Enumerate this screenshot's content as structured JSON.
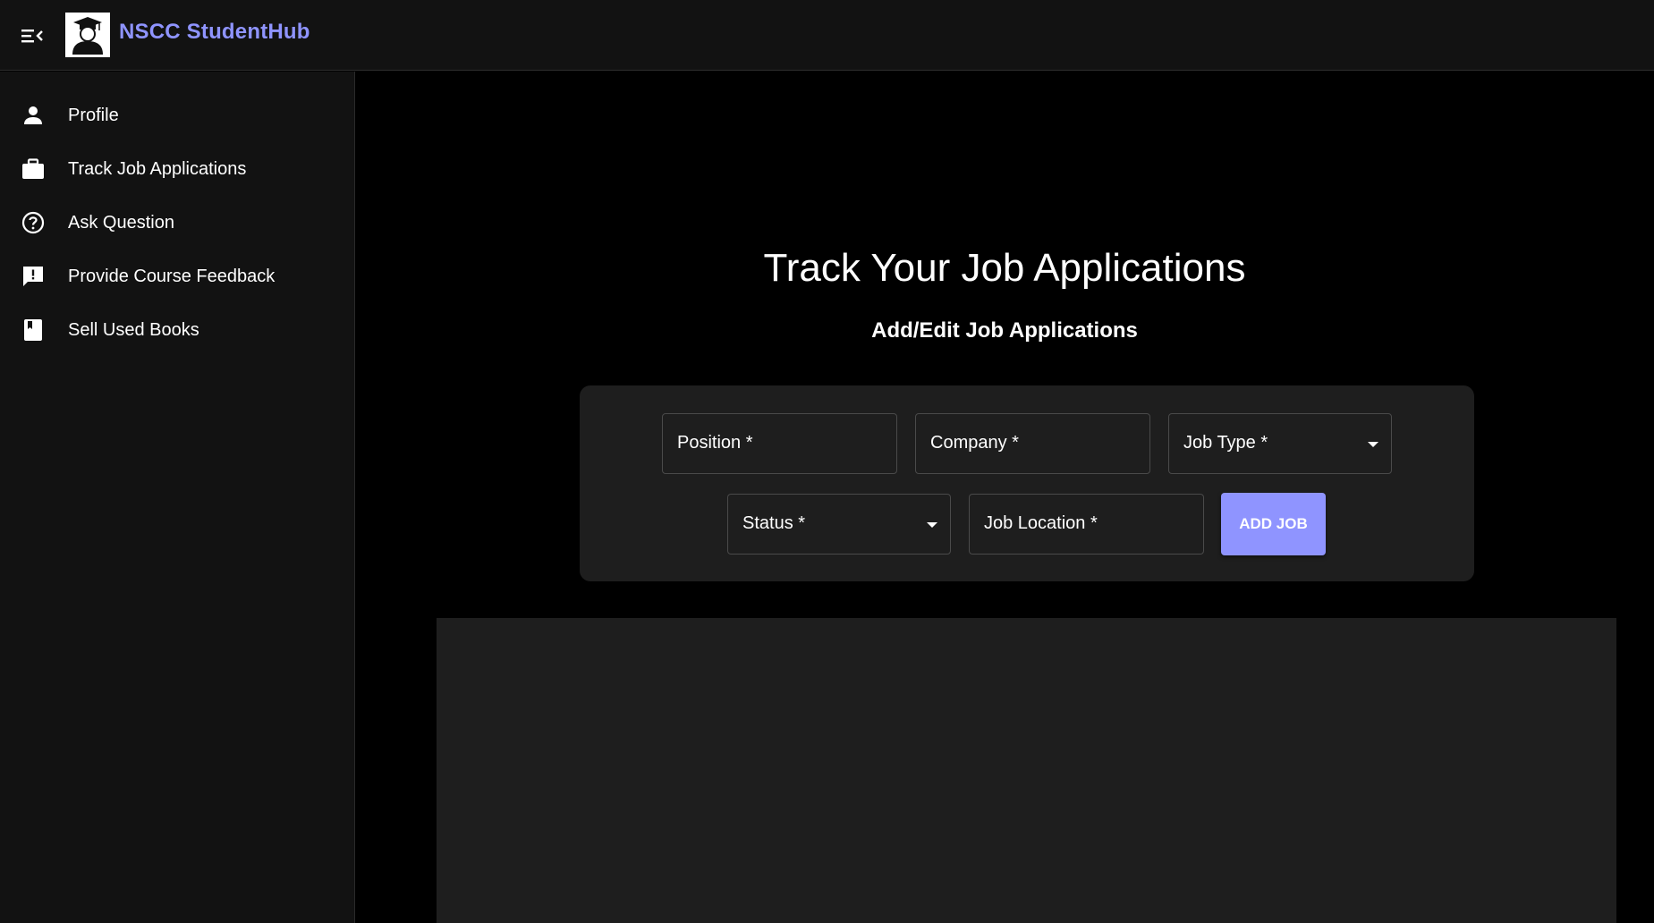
{
  "header": {
    "brand": "NSCC StudentHub",
    "menu_icon": "menu-open-icon",
    "logo_icon": "graduate-icon"
  },
  "sidebar": {
    "items": [
      {
        "label": "Profile",
        "icon": "person-icon"
      },
      {
        "label": "Track Job Applications",
        "icon": "briefcase-icon"
      },
      {
        "label": "Ask Question",
        "icon": "help-circle-icon"
      },
      {
        "label": "Provide Course Feedback",
        "icon": "feedback-icon"
      },
      {
        "label": "Sell Used Books",
        "icon": "book-icon"
      }
    ]
  },
  "main": {
    "title": "Track Your Job Applications",
    "subtitle": "Add/Edit Job Applications",
    "form": {
      "position_label": "Position *",
      "company_label": "Company *",
      "job_type_label": "Job Type *",
      "status_label": "Status *",
      "job_location_label": "Job Location *",
      "add_button": "ADD JOB"
    }
  },
  "colors": {
    "accent": "#8f94ff",
    "surface": "#1e1e1e",
    "sidebar": "#121212",
    "background": "#000000"
  }
}
